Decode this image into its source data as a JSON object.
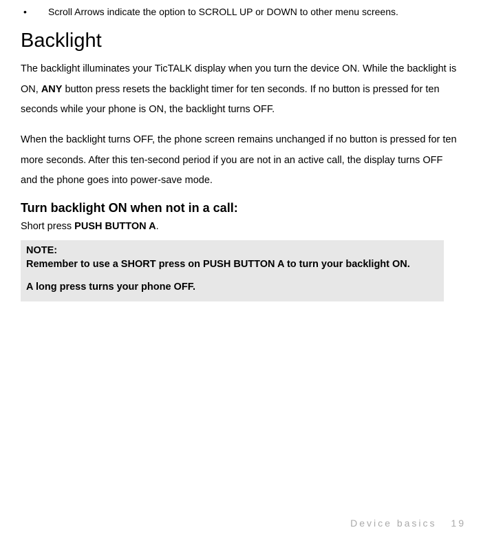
{
  "bullet": {
    "text": "Scroll Arrows indicate the option to SCROLL UP or DOWN to other menu screens."
  },
  "section": {
    "title": "Backlight"
  },
  "para1": {
    "pre": "The backlight illuminates your TicTALK display when you turn the device ON. While the backlight is ON, ",
    "bold": "ANY",
    "post": " button press resets the backlight timer for ten seconds. If no button is pressed for ten seconds while your phone is ON, the backlight turns OFF."
  },
  "para2": {
    "text": "When the backlight turns OFF, the phone screen remains unchanged if no button is pressed for ten more seconds. After this ten-second period if you are not in an active call, the display turns OFF and the phone goes into power-save mode."
  },
  "subsection": {
    "title": "Turn backlight ON when not in a call:"
  },
  "instruction": {
    "pre": "Short press ",
    "bold": "PUSH BUTTON A",
    "post": "."
  },
  "note": {
    "label": "NOTE:",
    "line1": "Remember to use a SHORT press on PUSH BUTTON A to turn your backlight ON.",
    "line2": "A long press turns your phone OFF."
  },
  "footer": {
    "section_name": "Device basics",
    "page": "19"
  }
}
